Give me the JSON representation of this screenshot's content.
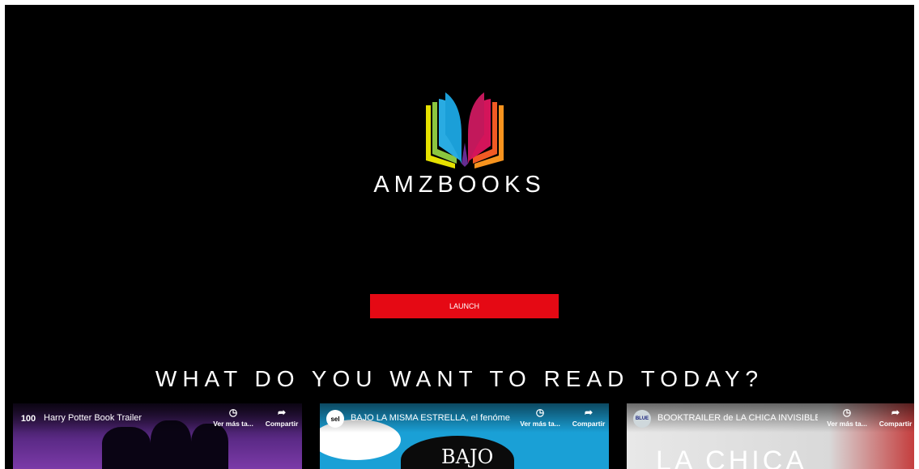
{
  "brand": {
    "name": "AMZBOOKS"
  },
  "hero": {
    "launch_label": "LAUNCH"
  },
  "section": {
    "heading": "WHAT DO YOU WANT TO READ TODAY?"
  },
  "videos": [
    {
      "avatar": "100",
      "title": "Harry Potter Book Trailer",
      "watch_later": "Ver más ta...",
      "share": "Compartir"
    },
    {
      "avatar": "sel",
      "title": "BAJO LA MISMA ESTRELLA, el fenóme...",
      "watch_later": "Ver más ta...",
      "share": "Compartir",
      "thumb_text": "BAJO"
    },
    {
      "avatar": "BLUE",
      "title": "BOOKTRAILER de LA CHICA INVISIBLE ...",
      "watch_later": "Ver más ta...",
      "share": "Compartir",
      "thumb_text": "LA CHICA"
    }
  ],
  "colors": {
    "background": "#000000",
    "accent": "#e50914",
    "text": "#ffffff"
  },
  "icons": {
    "logo": "open-book-logo-icon",
    "watch_later": "clock-icon",
    "share": "share-arrow-icon"
  }
}
